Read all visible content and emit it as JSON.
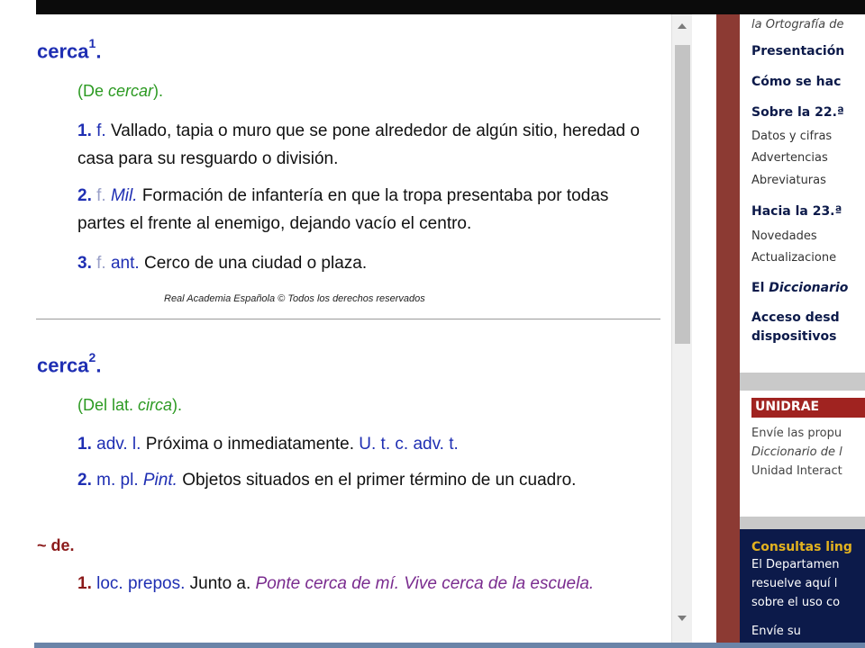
{
  "entry1": {
    "lemma": "cerca",
    "sup": "1",
    "etym_prefix": "(De ",
    "etym_word": "cercar",
    "etym_suffix": ").",
    "senses": [
      {
        "num": "1.",
        "gram": "f.",
        "text": "Vallado, tapia o muro que se pone alrededor de algún sitio, heredad o casa para su resguardo o división."
      },
      {
        "num": "2.",
        "gram": "f.",
        "field": "Mil.",
        "text": "Formación de infantería en que la tropa presentaba por todas partes el frente al enemigo, dejando vacío el centro."
      },
      {
        "num": "3.",
        "gram": "f.",
        "usage": "ant.",
        "text": "Cerco de una ciudad o plaza."
      }
    ]
  },
  "copyright": "Real Academia Española © Todos los derechos reservados",
  "entry2": {
    "lemma": "cerca",
    "sup": "2",
    "etym_prefix": "(Del lat. ",
    "etym_word": "circa",
    "etym_suffix": ").",
    "senses": [
      {
        "num": "1.",
        "gram": "adv. l.",
        "text": "Próxima o inmediatamente.",
        "note": "U. t. c. adv. t."
      },
      {
        "num": "2.",
        "gram": "m. pl.",
        "field": "Pint.",
        "text": "Objetos situados en el primer término de un cuadro."
      }
    ],
    "locution": "~ de.",
    "loc_sense": {
      "num": "1.",
      "gram": "loc. prepos.",
      "text": "Junto a.",
      "example": "Ponte cerca de mí. Vive cerca de la escuela."
    }
  },
  "right_panel": {
    "ortografia_partial": "la Ortografía de",
    "items": [
      {
        "label": "Presentación",
        "type": "head"
      },
      {
        "label": "Cómo se hac",
        "type": "head"
      },
      {
        "label": "Sobre la 22.ª",
        "type": "head"
      },
      {
        "label": "Datos y cifras",
        "type": "link"
      },
      {
        "label": "Advertencias",
        "type": "link"
      },
      {
        "label": "Abreviaturas",
        "type": "link"
      },
      {
        "label": "Hacia la 23.ª",
        "type": "head"
      },
      {
        "label": "Novedades",
        "type": "link"
      },
      {
        "label": "Actualizacione",
        "type": "link"
      },
      {
        "label": "El Diccionario",
        "type": "head"
      },
      {
        "label": "Acceso desd",
        "type": "head"
      },
      {
        "label": "dispositivos",
        "type": "head"
      }
    ],
    "unidrae": {
      "label": "UNIDRAE",
      "lines": [
        "Envíe las propu",
        "Diccionario de l",
        "Unidad Interact"
      ]
    },
    "consultas": {
      "title": "Consultas ling",
      "lines": [
        "El Departamen",
        "resuelve aquí l",
        "sobre el uso co"
      ],
      "more": "Envíe su"
    }
  },
  "colors": {
    "lemma_blue": "#1f2fb3",
    "etym_green": "#2c9a22",
    "example_purple": "#7a2c8f",
    "loc_red": "#8b1a1a",
    "panel_dark": "#0c1a4a",
    "unidrae_red": "#a02320"
  }
}
